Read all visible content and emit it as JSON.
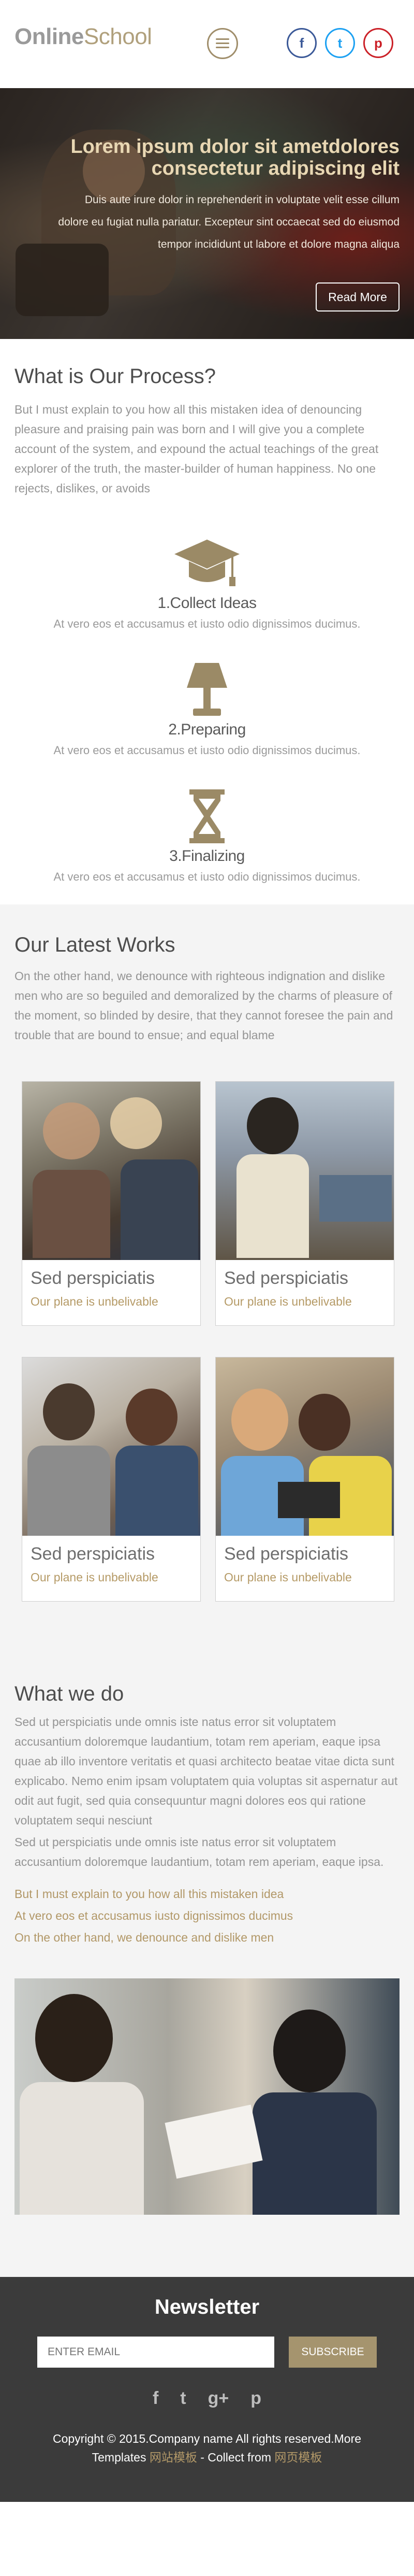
{
  "header": {
    "logo_part1": "Online",
    "logo_part2": "School",
    "social": [
      {
        "icon": "facebook-icon",
        "glyph": "f",
        "color": "#3b5998"
      },
      {
        "icon": "twitter-icon",
        "glyph": "t",
        "color": "#1da1f2"
      },
      {
        "icon": "pinterest-icon",
        "glyph": "p",
        "color": "#cb2027"
      }
    ]
  },
  "hero": {
    "title": "Lorem ipsum dolor sit ametdolores consectetur adipiscing elit",
    "description": "Duis aute irure dolor in reprehenderit in voluptate velit esse cillum dolore eu fugiat nulla pariatur. Excepteur sint occaecat sed do eiusmod tempor incididunt ut labore et dolore magna aliqua",
    "button": "Read More"
  },
  "process": {
    "title": "What is Our Process?",
    "intro": "But I must explain to you how all this mistaken idea of denouncing pleasure and praising pain was born and I will give you a complete account of the system, and expound the actual teachings of the great explorer of the truth, the master-builder of human happiness. No one rejects, dislikes, or avoids",
    "steps": [
      {
        "title": "1.Collect Ideas",
        "desc": "At vero eos et accusamus et iusto odio dignissimos ducimus."
      },
      {
        "title": "2.Preparing",
        "desc": "At vero eos et accusamus et iusto odio dignissimos ducimus."
      },
      {
        "title": "3.Finalizing",
        "desc": "At vero eos et accusamus et iusto odio dignissimos ducimus."
      }
    ]
  },
  "works": {
    "title": "Our Latest Works",
    "intro": "On the other hand, we denounce with righteous indignation and dislike men who are so beguiled and demoralized by the charms of pleasure of the moment, so blinded by desire, that they cannot foresee the pain and trouble that are bound to ensue; and equal blame",
    "cards": [
      {
        "title": "Sed perspiciatis",
        "subtitle": "Our plane is unbelivable"
      },
      {
        "title": "Sed perspiciatis",
        "subtitle": "Our plane is unbelivable"
      },
      {
        "title": "Sed perspiciatis",
        "subtitle": "Our plane is unbelivable"
      },
      {
        "title": "Sed perspiciatis",
        "subtitle": "Our plane is unbelivable"
      }
    ]
  },
  "whatwedo": {
    "title": "What we do",
    "para1": "Sed ut perspiciatis unde omnis iste natus error sit voluptatem accusantium doloremque laudantium, totam rem aperiam, eaque ipsa quae ab illo inventore veritatis et quasi architecto beatae vitae dicta sunt explicabo. Nemo enim ipsam voluptatem quia voluptas sit aspernatur aut odit aut fugit, sed quia consequuntur magni dolores eos qui ratione voluptatem sequi nesciunt",
    "para2": "Sed ut perspiciatis unde omnis iste natus error sit voluptatem accusantium doloremque laudantium, totam rem aperiam, eaque ipsa.",
    "links": [
      "But I must explain to you how all this mistaken idea",
      "At vero eos et accusamus iusto dignissimos ducimus",
      "On the other hand, we denounce and dislike men"
    ]
  },
  "newsletter": {
    "title": "Newsletter",
    "placeholder": "ENTER EMAIL",
    "button": "SUBSCRIBE",
    "social": [
      "f",
      "t",
      "g+",
      "p"
    ]
  },
  "footer": {
    "copyright": "Copyright © 2015.Company name All rights reserved.More Templates",
    "cn1": "网站模板",
    "collect": " - Collect from ",
    "cn2": "网页模板"
  },
  "colors": {
    "accent": "#b29868",
    "dark": "#3b3b3b",
    "text": "#959595"
  }
}
